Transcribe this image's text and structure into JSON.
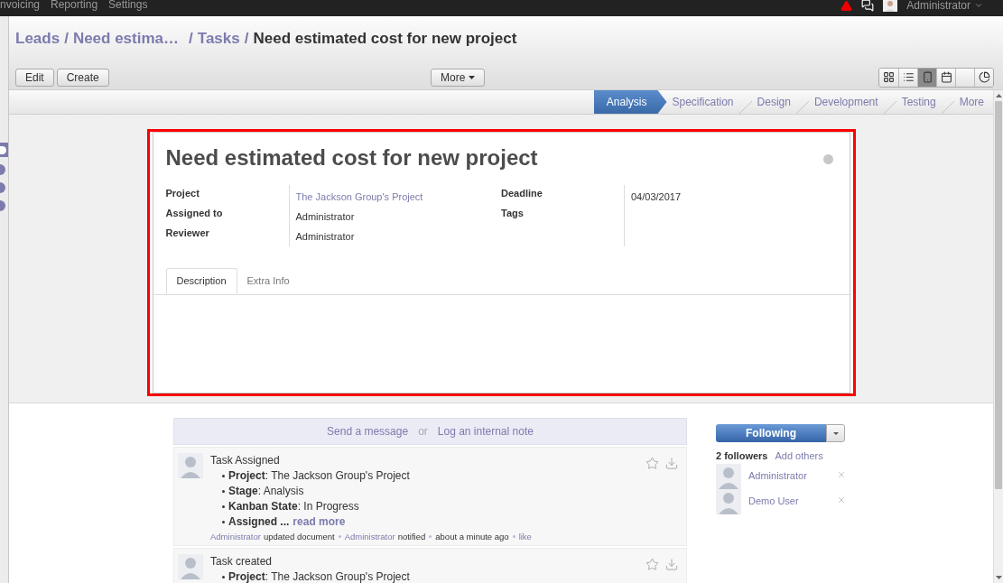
{
  "top_menu": [
    {
      "label": "nvoicing"
    },
    {
      "label": "Reporting"
    },
    {
      "label": "Settings"
    }
  ],
  "user": {
    "name": "Administrator"
  },
  "breadcrumbs": [
    {
      "label": "Leads",
      "kind": "link"
    },
    {
      "sep": "/",
      "label": "Need estima…",
      "kind": "link"
    },
    {
      "sep": "/",
      "label": "Tasks",
      "kind": "link"
    },
    {
      "sep": "/",
      "label": "Need estimated cost for new project",
      "kind": "current"
    }
  ],
  "actions": [
    {
      "label": "Edit"
    },
    {
      "label": "Create"
    }
  ],
  "more_menu": {
    "label": "More"
  },
  "views": [
    {
      "kind": "kanban",
      "selected": false
    },
    {
      "kind": "list",
      "selected": false
    },
    {
      "kind": "form",
      "selected": true
    },
    {
      "kind": "calendar",
      "selected": false
    },
    {
      "kind": "blank",
      "selected": false
    },
    {
      "kind": "graph",
      "selected": false
    }
  ],
  "stages": [
    {
      "label": "Analysis",
      "selected": true
    },
    {
      "label": "Specification",
      "selected": false
    },
    {
      "label": "Design",
      "selected": false
    },
    {
      "label": "Development",
      "selected": false
    },
    {
      "label": "Testing",
      "selected": false
    },
    {
      "label": "More",
      "selected": false
    }
  ],
  "record": {
    "title": "Need estimated cost for new project",
    "left_fields": [
      {
        "label": "Project",
        "value": "The Jackson Group's Project",
        "kind": "link"
      },
      {
        "label": "Assigned to",
        "value": "Administrator",
        "kind": "text"
      },
      {
        "label": "Reviewer",
        "value": "Administrator",
        "kind": "text"
      }
    ],
    "right_fields": [
      {
        "label": "Deadline",
        "value": "04/03/2017"
      },
      {
        "label": "Tags"
      }
    ],
    "tabs": [
      {
        "label": "Description",
        "selected": true
      },
      {
        "label": "Extra Info",
        "selected": false
      }
    ]
  },
  "composer": {
    "send": "Send a message",
    "or": "or",
    "log": "Log an internal note"
  },
  "messages": [
    {
      "title": "Task Assigned",
      "items": [
        {
          "text": "**Project**: The Jackson Group's Project"
        },
        {
          "text": "**Stage**: Analysis"
        },
        {
          "text": "**Kanban State**: In Progress"
        },
        {
          "text": "**Assigned ...**",
          "more": "read more"
        }
      ],
      "footer": [
        {
          "text": "Administrator",
          "kind": "link"
        },
        {
          "text": "updated document",
          "kind": "text"
        },
        {
          "kind": "dot"
        },
        {
          "text": "Administrator",
          "kind": "link"
        },
        {
          "text": "notified",
          "kind": "text"
        },
        {
          "kind": "dot"
        },
        {
          "text": "about a minute ago",
          "kind": "text"
        },
        {
          "kind": "dot"
        },
        {
          "text": "like",
          "kind": "link"
        }
      ]
    },
    {
      "title": "Task created",
      "items": [
        {
          "text": "**Project**: The Jackson Group's Project"
        }
      ]
    }
  ],
  "followers": {
    "button": "Following",
    "count": "2 followers",
    "add": "Add others",
    "list": [
      {
        "name": "Administrator"
      },
      {
        "name": "Demo User"
      }
    ]
  }
}
